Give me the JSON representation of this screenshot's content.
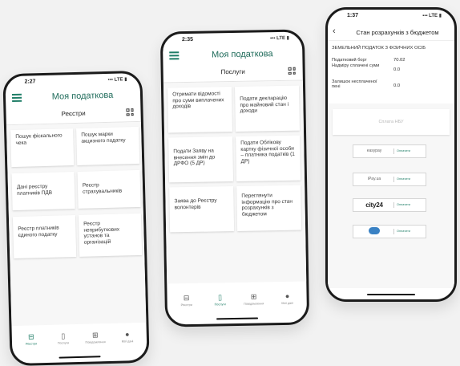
{
  "phone1": {
    "time": "2:27",
    "signal": "LTE",
    "app_title": "Моя податкова",
    "section_title": "Реєстри",
    "tiles": [
      "Пошук фіскального чека",
      "Пошук марки акцизного податку",
      "Дані реєстру платників ПДВ",
      "Реєстр страхувальників",
      "Реєстр платників єдиного податку",
      "Реєстр неприбуткових установ та організацій"
    ],
    "nav": [
      "Реєстри",
      "Послуги",
      "Повідомлення",
      "Мої дані"
    ],
    "active_nav": "Реєстри"
  },
  "phone2": {
    "time": "2:35",
    "signal": "LTE",
    "app_title": "Моя податкова",
    "section_title": "Послуги",
    "tiles": [
      "Отримати відомості про суми виплачених доходів",
      "Подати декларацію про майновий стан і доходи",
      "Подати Заяву на внесення змін до ДРФО (5 ДР)",
      "Подати Облікову картку фізичної особи – платника податків (1 ДР)",
      "Заява до Реєстру волонтерів",
      "Переглянути інформацію про стан розрахунків з бюджетом"
    ],
    "nav": [
      "Реєстри",
      "Послуги",
      "Повідомлення",
      "Мої дані"
    ],
    "active_nav": "Послуги"
  },
  "phone3": {
    "time": "1:37",
    "signal": "LTE",
    "title": "Стан розрахунків з бюджетом",
    "section": "ЗЕМЕЛЬНИЙ ПОДАТОК З ФІЗИЧНИХ ОСІБ",
    "rows": [
      {
        "label": "Податковий борг",
        "value": "70.02"
      },
      {
        "label": "Надміру сплачені суми",
        "value": "0.0"
      },
      {
        "label": "Залишок несплаченої пені",
        "value": "0.0"
      }
    ],
    "nbu_button": "Сплата НБУ",
    "payments": [
      {
        "logo": "easypay",
        "label": "Оплатити"
      },
      {
        "logo": "iPay.ua",
        "label": "Оплатити"
      },
      {
        "logo": "city24",
        "label": "Оплатити"
      },
      {
        "logo": "bank-logo",
        "label": "Оплатити"
      }
    ]
  },
  "colors": {
    "accent": "#1e7d66",
    "background": "#f2f2f2"
  }
}
